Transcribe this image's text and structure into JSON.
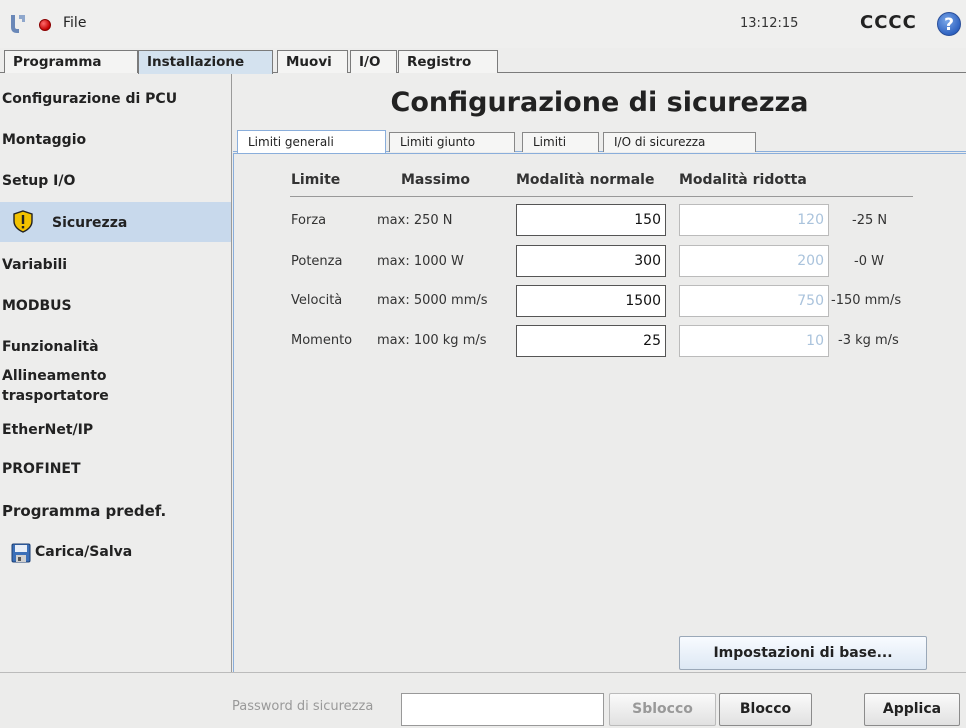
{
  "topbar": {
    "file_label": "File",
    "time": "13:12:15",
    "robot_name": "CCCC",
    "help_symbol": "?"
  },
  "main_tabs": [
    {
      "label": "Programma",
      "active": false
    },
    {
      "label": "Installazione",
      "active": true
    },
    {
      "label": "Muovi",
      "active": false
    },
    {
      "label": "I/O",
      "active": false
    },
    {
      "label": "Registro",
      "active": false
    }
  ],
  "sidebar": {
    "items": [
      {
        "label": "Configurazione di PCU"
      },
      {
        "label": "Montaggio"
      },
      {
        "label": "Setup I/O"
      },
      {
        "label": "Sicurezza",
        "active": true,
        "icon": "warning-shield-icon"
      },
      {
        "label": "Variabili"
      },
      {
        "label": "MODBUS"
      },
      {
        "label": "Funzionalità"
      },
      {
        "label": "Allineamento"
      },
      {
        "label": "trasportatore"
      },
      {
        "label": "EtherNet/IP"
      },
      {
        "label": "PROFINET"
      },
      {
        "label": "Programma predef."
      },
      {
        "label": "Carica/Salva",
        "icon": "save-disk-icon"
      }
    ]
  },
  "page": {
    "title": "Configurazione di sicurezza"
  },
  "sub_tabs": [
    {
      "label": "Limiti generali",
      "active": true
    },
    {
      "label": "Limiti giunto",
      "active": false
    },
    {
      "label": "Limiti",
      "active": false
    },
    {
      "label": "I/O di sicurezza",
      "active": false
    }
  ],
  "limits_table": {
    "headers": {
      "limit": "Limite",
      "max": "Massimo",
      "normal": "Modalità normale",
      "reduced": "Modalità ridotta"
    },
    "rows": [
      {
        "name": "Forza",
        "max": "max: 250 N",
        "normal": "150",
        "reduced": "120",
        "diff": "-25 N"
      },
      {
        "name": "Potenza",
        "max": "max: 1000 W",
        "normal": "300",
        "reduced": "200",
        "diff": "-0 W"
      },
      {
        "name": "Velocità",
        "max": "max: 5000 mm/s",
        "normal": "1500",
        "reduced": "750",
        "diff": "-150 mm/s"
      },
      {
        "name": "Momento",
        "max": "max: 100 kg m/s",
        "normal": "25",
        "reduced": "10",
        "diff": "-3 kg m/s"
      }
    ]
  },
  "base_settings_button": "Impostazioni di base...",
  "bottombar": {
    "password_label": "Password di sicurezza",
    "password_value": "",
    "unlock_label": "Sblocco",
    "lock_label": "Blocco",
    "apply_label": "Applica"
  },
  "colors": {
    "accent_tab": "#d4e2ef",
    "sidebar_active": "#c8d9ec",
    "reduced_text": "#aac3dc",
    "status_red": "#c40000",
    "help_blue": "#2b5fbf"
  }
}
